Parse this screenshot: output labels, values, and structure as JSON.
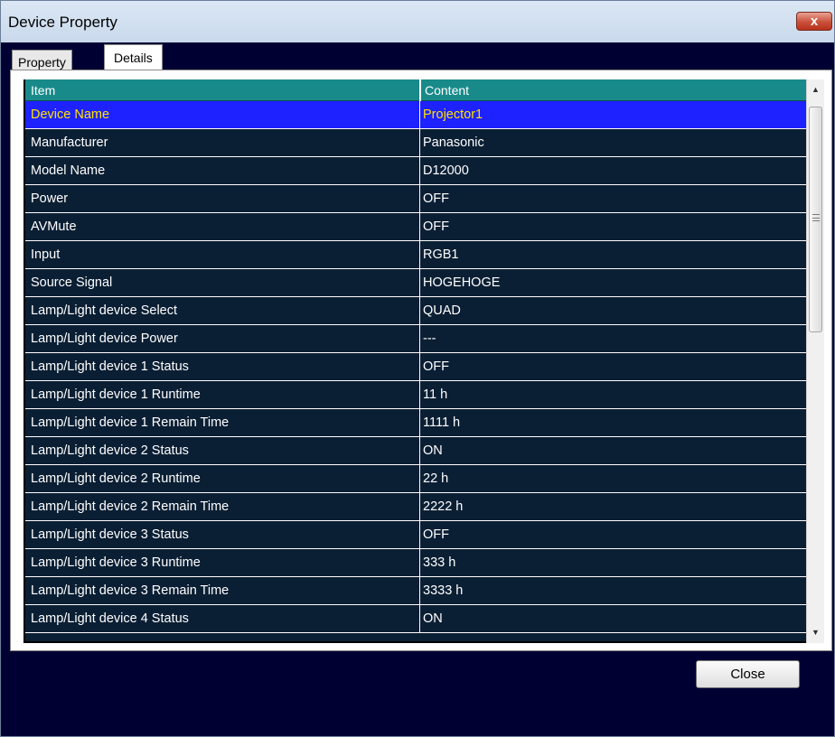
{
  "window": {
    "title": "Device Property",
    "close_glyph": "x"
  },
  "tabs": [
    {
      "label": "Property",
      "active": false
    },
    {
      "label": "Details",
      "active": true
    }
  ],
  "table": {
    "columns": [
      "Item",
      "Content"
    ],
    "rows": [
      {
        "item": "Device Name",
        "content": "Projector1",
        "selected": true
      },
      {
        "item": "Manufacturer",
        "content": "Panasonic"
      },
      {
        "item": "Model Name",
        "content": "D12000"
      },
      {
        "item": "Power",
        "content": "OFF"
      },
      {
        "item": "AVMute",
        "content": "OFF"
      },
      {
        "item": "Input",
        "content": "RGB1"
      },
      {
        "item": "Source Signal",
        "content": "HOGEHOGE"
      },
      {
        "item": "Lamp/Light device Select",
        "content": "QUAD"
      },
      {
        "item": "Lamp/Light device Power",
        "content": "---"
      },
      {
        "item": "Lamp/Light device 1 Status",
        "content": "OFF"
      },
      {
        "item": "Lamp/Light device 1 Runtime",
        "content": "11 h"
      },
      {
        "item": "Lamp/Light device 1 Remain Time",
        "content": "1111 h"
      },
      {
        "item": "Lamp/Light device 2 Status",
        "content": "ON"
      },
      {
        "item": "Lamp/Light device 2 Runtime",
        "content": "22 h"
      },
      {
        "item": "Lamp/Light device 2 Remain Time",
        "content": "2222 h"
      },
      {
        "item": "Lamp/Light device 3 Status",
        "content": "OFF"
      },
      {
        "item": "Lamp/Light device 3 Runtime",
        "content": "333 h"
      },
      {
        "item": "Lamp/Light device 3 Remain Time",
        "content": "3333 h"
      },
      {
        "item": "Lamp/Light device 4 Status",
        "content": "ON"
      }
    ]
  },
  "colors": {
    "window_bg": "#000033",
    "header_bg": "#198a8a",
    "row_bg": "#0b1f34",
    "selected_bg": "#1d22ff",
    "selected_text": "#ffe100"
  },
  "footer": {
    "close_label": "Close"
  },
  "icons": {
    "scroll_up": "scroll-up-arrow-icon",
    "scroll_down": "scroll-down-arrow-icon",
    "grip": "scrollbar-grip-icon"
  }
}
